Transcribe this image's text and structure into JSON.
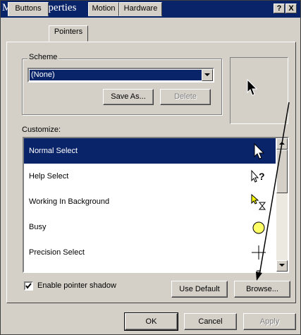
{
  "window": {
    "title": "Mouse Properties",
    "help_label": "?",
    "close_label": "X"
  },
  "tabs": [
    {
      "label": "Buttons"
    },
    {
      "label": "Pointers"
    },
    {
      "label": "Motion"
    },
    {
      "label": "Hardware"
    }
  ],
  "scheme": {
    "group_label": "Scheme",
    "selected_value": "(None)",
    "save_as_label": "Save As...",
    "delete_label": "Delete"
  },
  "customize": {
    "label": "Customize:",
    "items": [
      {
        "label": "Normal Select",
        "icon": "arrow-pointer-icon",
        "selected": true
      },
      {
        "label": "Help Select",
        "icon": "help-pointer-icon"
      },
      {
        "label": "Working In Background",
        "icon": "working-pointer-icon"
      },
      {
        "label": "Busy",
        "icon": "busy-pointer-icon"
      },
      {
        "label": "Precision Select",
        "icon": "crosshair-pointer-icon"
      },
      {
        "label": "",
        "icon": "text-beam-pointer-icon"
      }
    ]
  },
  "shadow": {
    "label": "Enable pointer shadow",
    "checked": true
  },
  "buttons": {
    "use_default": "Use Default",
    "browse": "Browse...",
    "ok": "OK",
    "cancel": "Cancel",
    "apply": "Apply"
  },
  "colors": {
    "titlebar": "#0a246a",
    "face": "#d4d0c8",
    "selection": "#0a246a"
  }
}
